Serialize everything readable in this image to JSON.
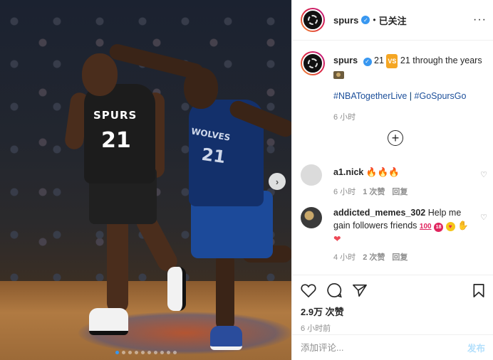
{
  "post": {
    "dots_count": 10,
    "active_dot": 0
  },
  "header": {
    "username": "spurs",
    "separator": "•",
    "follow_label": "已关注",
    "more_glyph": "···"
  },
  "caption": {
    "username": "spurs",
    "text_prefix": "21",
    "badge": "VS",
    "text_suffix": "21 through the years",
    "hashtag1": "#NBATogetherLive",
    "hashtag_sep": "|",
    "hashtag2": "#GoSpursGo",
    "time": "6 小时"
  },
  "comments": [
    {
      "username": "a1.nick",
      "text": "🔥🔥🔥",
      "time": "6 小时",
      "likes": "1 次赞",
      "reply": "回复"
    },
    {
      "username": "addicted_memes_302",
      "text_prefix": "Help me gain followers friends",
      "badge_100": "100",
      "badge_18": "18",
      "time": "4 小时",
      "likes": "2 次赞",
      "reply": "回复"
    }
  ],
  "actions": {
    "likes": "2.9万 次赞",
    "posted": "6 小时前"
  },
  "composer": {
    "placeholder": "添加评论...",
    "post_label": "发布"
  },
  "photo": {
    "jersey1_text": "SPURS",
    "jersey1_number": "21",
    "jersey2_text": "WOLVES",
    "jersey2_number": "21"
  },
  "colors": {
    "verified": "#3897f0",
    "link": "#1c4f9a",
    "muted": "#8e8e8e",
    "post_button": "#b2dffc"
  }
}
